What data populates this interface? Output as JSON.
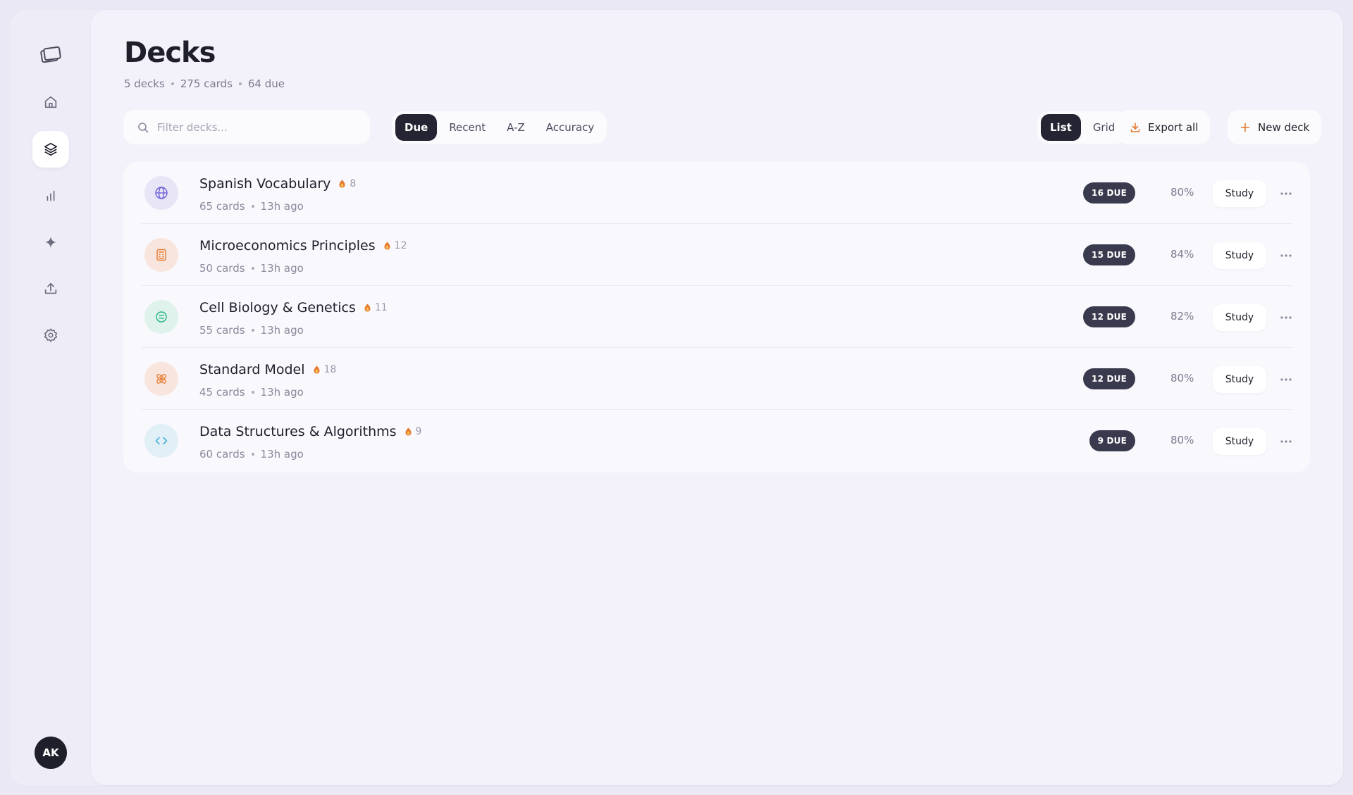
{
  "page": {
    "title": "Decks",
    "stats": {
      "decks": "5 decks",
      "cards": "275 cards",
      "due": "64 due"
    }
  },
  "sidebar": {
    "items": [
      {
        "icon": "cards-logo-icon"
      },
      {
        "icon": "home-icon"
      },
      {
        "icon": "layers-icon",
        "active": true
      },
      {
        "icon": "bar-chart-icon"
      },
      {
        "icon": "sparkle-icon"
      },
      {
        "icon": "upload-icon"
      },
      {
        "icon": "gear-icon"
      }
    ],
    "avatar_initials": "AK"
  },
  "toolbar": {
    "search_placeholder": "Filter decks...",
    "sort_options": [
      "Due",
      "Recent",
      "A-Z",
      "Accuracy"
    ],
    "sort_selected": "Due",
    "view_options": [
      "List",
      "Grid"
    ],
    "view_selected": "List",
    "export_label": "Export all",
    "new_deck_label": "New deck"
  },
  "decks": [
    {
      "name": "Spanish Vocabulary",
      "streak": "8",
      "cards": "65 cards",
      "updated": "13h ago",
      "due": "16 DUE",
      "accuracy": "80%",
      "study_label": "Study",
      "icon": "globe-icon",
      "icon_bg": "#e8e6f6",
      "icon_color": "#6b5fd6"
    },
    {
      "name": "Microeconomics Principles",
      "streak": "12",
      "cards": "50 cards",
      "updated": "13h ago",
      "due": "15 DUE",
      "accuracy": "84%",
      "study_label": "Study",
      "icon": "calculator-icon",
      "icon_bg": "#f8e6de",
      "icon_color": "#e67a2e"
    },
    {
      "name": "Cell Biology & Genetics",
      "streak": "11",
      "cards": "55 cards",
      "updated": "13h ago",
      "due": "12 DUE",
      "accuracy": "82%",
      "study_label": "Study",
      "icon": "cell-icon",
      "icon_bg": "#dff2ec",
      "icon_color": "#22b585"
    },
    {
      "name": "Standard Model",
      "streak": "18",
      "cards": "45 cards",
      "updated": "13h ago",
      "due": "12 DUE",
      "accuracy": "80%",
      "study_label": "Study",
      "icon": "atom-icon",
      "icon_bg": "#f8e6de",
      "icon_color": "#e67a2e"
    },
    {
      "name": "Data Structures & Algorithms",
      "streak": "9",
      "cards": "60 cards",
      "updated": "13h ago",
      "due": "9 DUE",
      "accuracy": "80%",
      "study_label": "Study",
      "icon": "code-icon",
      "icon_bg": "#e0f0f6",
      "icon_color": "#3aa8d8"
    }
  ],
  "colors": {
    "accent_orange": "#e67a2e",
    "dark": "#242433",
    "badge": "#393a4d"
  }
}
